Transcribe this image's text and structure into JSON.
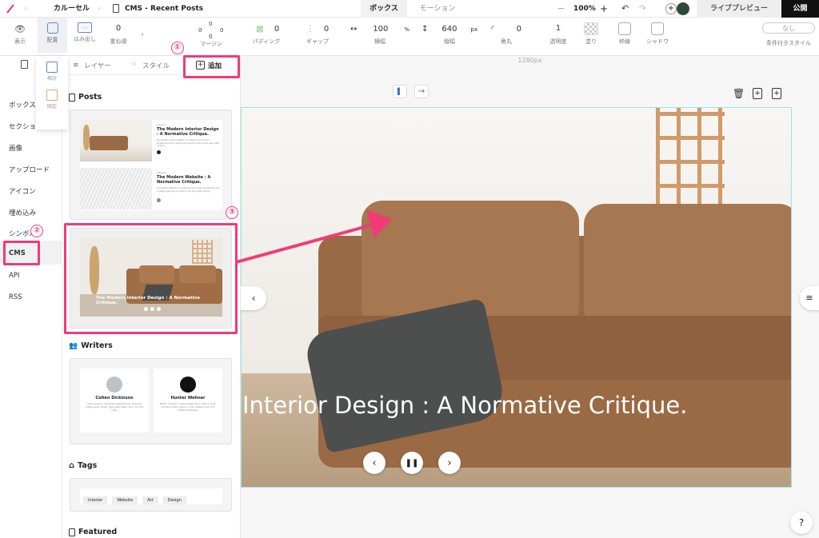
{
  "topbar": {
    "breadcrumb_1": "カルーセル",
    "breadcrumb_2": "CMS - Recent Posts",
    "tab_box": "ボックス",
    "tab_motion": "モーション",
    "zoom": "100%",
    "live_preview": "ライブプレビュー",
    "publish": "公開"
  },
  "toolbar": {
    "display": "表示",
    "layout": "配置",
    "overflow": "はみ出し",
    "stack": "重ね順",
    "stack_value": "0",
    "margin": "マージン",
    "margin_values": [
      "0",
      "0",
      "0",
      "0"
    ],
    "padding": "パディング",
    "padding_value": "0",
    "gap": "ギャップ",
    "gap_value": "0",
    "width": "横幅",
    "width_value": "100",
    "width_unit": "%",
    "height": "縦幅",
    "height_value": "640",
    "height_unit": "px",
    "radius": "角丸",
    "radius_value": "0",
    "opacity": "透明度",
    "opacity_value": "1",
    "fill": "塗り",
    "border": "枠線",
    "shadow": "シャドウ",
    "cond_value": "なし",
    "cond": "条件付きスタイル"
  },
  "position_popup": {
    "relative": "相対",
    "fixed": "固定"
  },
  "panel_tabs": {
    "layers": "レイヤー",
    "style": "スタイル",
    "add": "追加"
  },
  "left_nav": [
    "ボックス",
    "セクション",
    "画像",
    "アップロード",
    "アイコン",
    "埋め込み",
    "シンボル",
    "CMS",
    "API",
    "RSS"
  ],
  "sections": {
    "posts": "Posts",
    "writers": "Writers",
    "tags": "Tags",
    "featured": "Featured"
  },
  "post_preview": {
    "items": [
      {
        "tag": "Interior",
        "title": "The Modern Interior Design : A Normative Critique.",
        "body": "The Modern Interior Design is a reference to modern architecture and a design style that is rooted in the early 20th century."
      },
      {
        "tag": "Website",
        "title": "The Modern Website : A Normative Critique.",
        "body": "The Modern Website is a reference to modern architecture and a design style that is rooted in the early 20th century."
      }
    ]
  },
  "carousel_preview": {
    "caption": "The Modern Interior Design : A Normative Critique."
  },
  "writers": [
    {
      "name": "Colten Dickinson",
      "bio": "Internet guru. Devoted twitteraholic. General coffee geek. Music advocate. Beer nerd. Alcohol ninja."
    },
    {
      "name": "Hunter Wehner",
      "bio": "Writer. Analyst. Unapologetic pop culture lover. Zombie junkie. Bacon ninja. Twitter buff. Evil coffee trailblazer."
    }
  ],
  "tags": [
    "Interior",
    "Website",
    "Art",
    "Design"
  ],
  "canvas": {
    "ruler_label": "1280px",
    "slide_title": "Interior Design : A Normative Critique."
  },
  "annotations": {
    "step1": "①",
    "step2": "②",
    "step3": "③"
  },
  "help": "?",
  "colors": {
    "annotation": "#f03b78",
    "accent": "#3b6fd6"
  }
}
